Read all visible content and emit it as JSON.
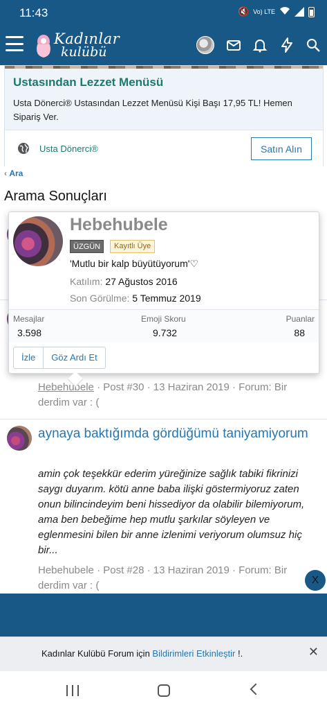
{
  "status_bar": {
    "time": "11:43",
    "indicators": "Vo) LTE"
  },
  "header": {
    "logo_line1": "Kadınlar",
    "logo_line2": "kulübü",
    "icons": [
      "menu-icon",
      "avatar",
      "mail-icon",
      "bell-icon",
      "bolt-icon",
      "search-icon"
    ]
  },
  "ad": {
    "title": "Ustasından Lezzet Menüsü",
    "description": "Usta Dönerci® Ustasından Lezzet Menüsü Kişi Başı 17,95 TL! Hemen Sipariş Ver.",
    "brand": "Usta Dönerci®",
    "cta": "Satın Alın"
  },
  "breadcrumb": {
    "label": "Ara"
  },
  "page_title": "Arama Sonuçları",
  "tooltip": {
    "name": "Hebehubele",
    "badge_status": "ÜZGÜN",
    "badge_role": "Kayıtlı Üye",
    "status_message": "'Mutlu bir kalp büyütüyorum'♡",
    "joined_label": "Katılım:",
    "joined_value": "27 Ağustos 2016",
    "last_seen_label": "Son Görülme:",
    "last_seen_value": "5 Temmuz 2019",
    "stats": [
      {
        "label": "Mesajlar",
        "value": "3.598"
      },
      {
        "label": "Emoji Skoru",
        "value": "9.732"
      },
      {
        "label": "Puanlar",
        "value": "88"
      }
    ],
    "follow_button": "İzle",
    "ignore_button": "Göz Ardı Et"
  },
  "results": [
    {
      "meta_author": "Hebehubele",
      "meta_rest": " · Post #30 · 13 Haziran 2019 · Forum: Bir derdim var : ("
    },
    {
      "title": "aynaya baktığımda gördüğümü taniyamiyorum",
      "snippet": "amin çok teşekkür ederim yüreğinize sağlık tabiki fikrinizi saygı duyarım. kötü anne baba ilişki göstermiyoruz zaten onun bilincindeyim beni hissediyor da olabilir bilemiyorum, ama ben bebeğime hep mutlu şarkılar söyleyen ve eglenmesini bilen bir anne izlenimi veriyorum olumsuz hiç bir...",
      "meta_author": "Hebehubele",
      "meta_rest": " · Post #28 · 13 Haziran 2019 · Forum: Bir derdim var : ("
    }
  ],
  "floating_close": "X",
  "notification": {
    "text_before": "Kadınlar Kulübü Forum için ",
    "link": "Bildirimleri Etkinleştir",
    "text_after": " !.",
    "close": "✕"
  }
}
